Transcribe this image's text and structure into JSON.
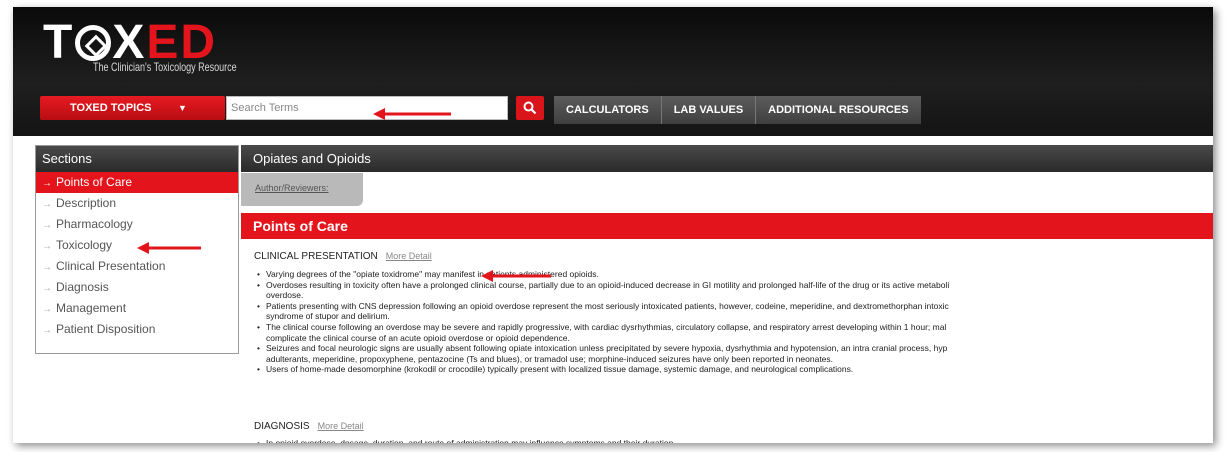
{
  "logo": {
    "part1": "T",
    "part2": "X",
    "part3": "ED",
    "tagline": "The Clinician's Toxicology Resource"
  },
  "nav": {
    "topics_label": "TOXED TOPICS",
    "search_placeholder": "Search Terms",
    "tabs": [
      "CALCULATORS",
      "LAB VALUES",
      "ADDITIONAL RESOURCES"
    ]
  },
  "sidebar": {
    "title": "Sections",
    "items": [
      {
        "label": "Points of Care"
      },
      {
        "label": "Description"
      },
      {
        "label": "Pharmacology"
      },
      {
        "label": "Toxicology"
      },
      {
        "label": "Clinical Presentation"
      },
      {
        "label": "Diagnosis"
      },
      {
        "label": "Management"
      },
      {
        "label": "Patient Disposition"
      }
    ]
  },
  "main": {
    "title": "Opiates and Opioids",
    "author_link": "Author/Reviewers:",
    "points_of_care": "Points of Care",
    "clinical": {
      "heading": "CLINICAL PRESENTATION",
      "more": "More Detail",
      "bullets": [
        {
          "lines": [
            "Varying degrees of the \"opiate toxidrome\" may manifest in patients administered opioids."
          ]
        },
        {
          "lines": [
            "Overdoses resulting in toxicity often have a prolonged clinical course, partially due to an opioid-induced decrease in GI motility and prolonged half-life of the drug or its active metaboli",
            "overdose."
          ]
        },
        {
          "lines": [
            "Patients presenting with CNS depression following an opioid overdose represent the most seriously intoxicated patients, however, codeine, meperidine, and dextromethorphan intoxic",
            "syndrome of stupor and delirium."
          ]
        },
        {
          "lines": [
            "The clinical course following an overdose may be severe and rapidly progressive, with cardiac dysrhythmias, circulatory collapse, and respiratory arrest developing within 1 hour; mal",
            "complicate the clinical course of an acute opioid overdose or opioid dependence."
          ]
        },
        {
          "lines": [
            "Seizures and focal neurologic signs are usually absent following opiate intoxication unless precipitated by severe hypoxia, dysrhythmia and hypotension, an intra cranial process, hyp",
            "adulterants, meperidine, propoxyphene, pentazocine (Ts and blues), or tramadol use; morphine-induced seizures have only been reported in neonates."
          ]
        },
        {
          "lines": [
            "Users of home-made desomorphine (krokodil or crocodile) typically present with localized tissue damage, systemic damage, and neurological complications."
          ]
        }
      ]
    },
    "diagnosis": {
      "heading": "DIAGNOSIS",
      "more": "More Detail",
      "bullets": [
        {
          "lines": [
            "In opioid overdose, dosage, duration, and route of administration may influence symptoms and their duration."
          ]
        }
      ]
    }
  },
  "colors": {
    "brand_red": "#e3141b",
    "header_black": "#111111",
    "arrow_red": "#e3141b"
  }
}
